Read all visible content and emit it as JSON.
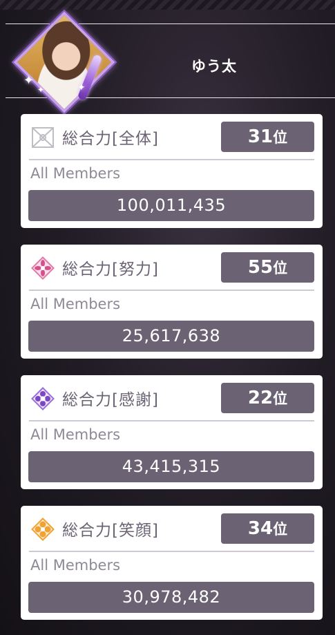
{
  "user": {
    "name": "ゆう太"
  },
  "rankings": [
    {
      "title": "総合力[全体]",
      "rank": "31",
      "rank_unit": "位",
      "scope": "All Members",
      "value": "100,011,435",
      "icon": "all-ribbon-icon",
      "accent": "#c6c6cc"
    },
    {
      "title": "総合力[努力]",
      "rank": "55",
      "rank_unit": "位",
      "scope": "All Members",
      "value": "25,617,638",
      "icon": "effort-flower-icon",
      "accent": "#d94f8e"
    },
    {
      "title": "総合力[感謝]",
      "rank": "22",
      "rank_unit": "位",
      "scope": "All Members",
      "value": "43,415,315",
      "icon": "gratitude-flower-icon",
      "accent": "#7a48c4"
    },
    {
      "title": "総合力[笑顔]",
      "rank": "34",
      "rank_unit": "位",
      "scope": "All Members",
      "value": "30,978,482",
      "icon": "smile-flower-icon",
      "accent": "#f0a234"
    }
  ]
}
